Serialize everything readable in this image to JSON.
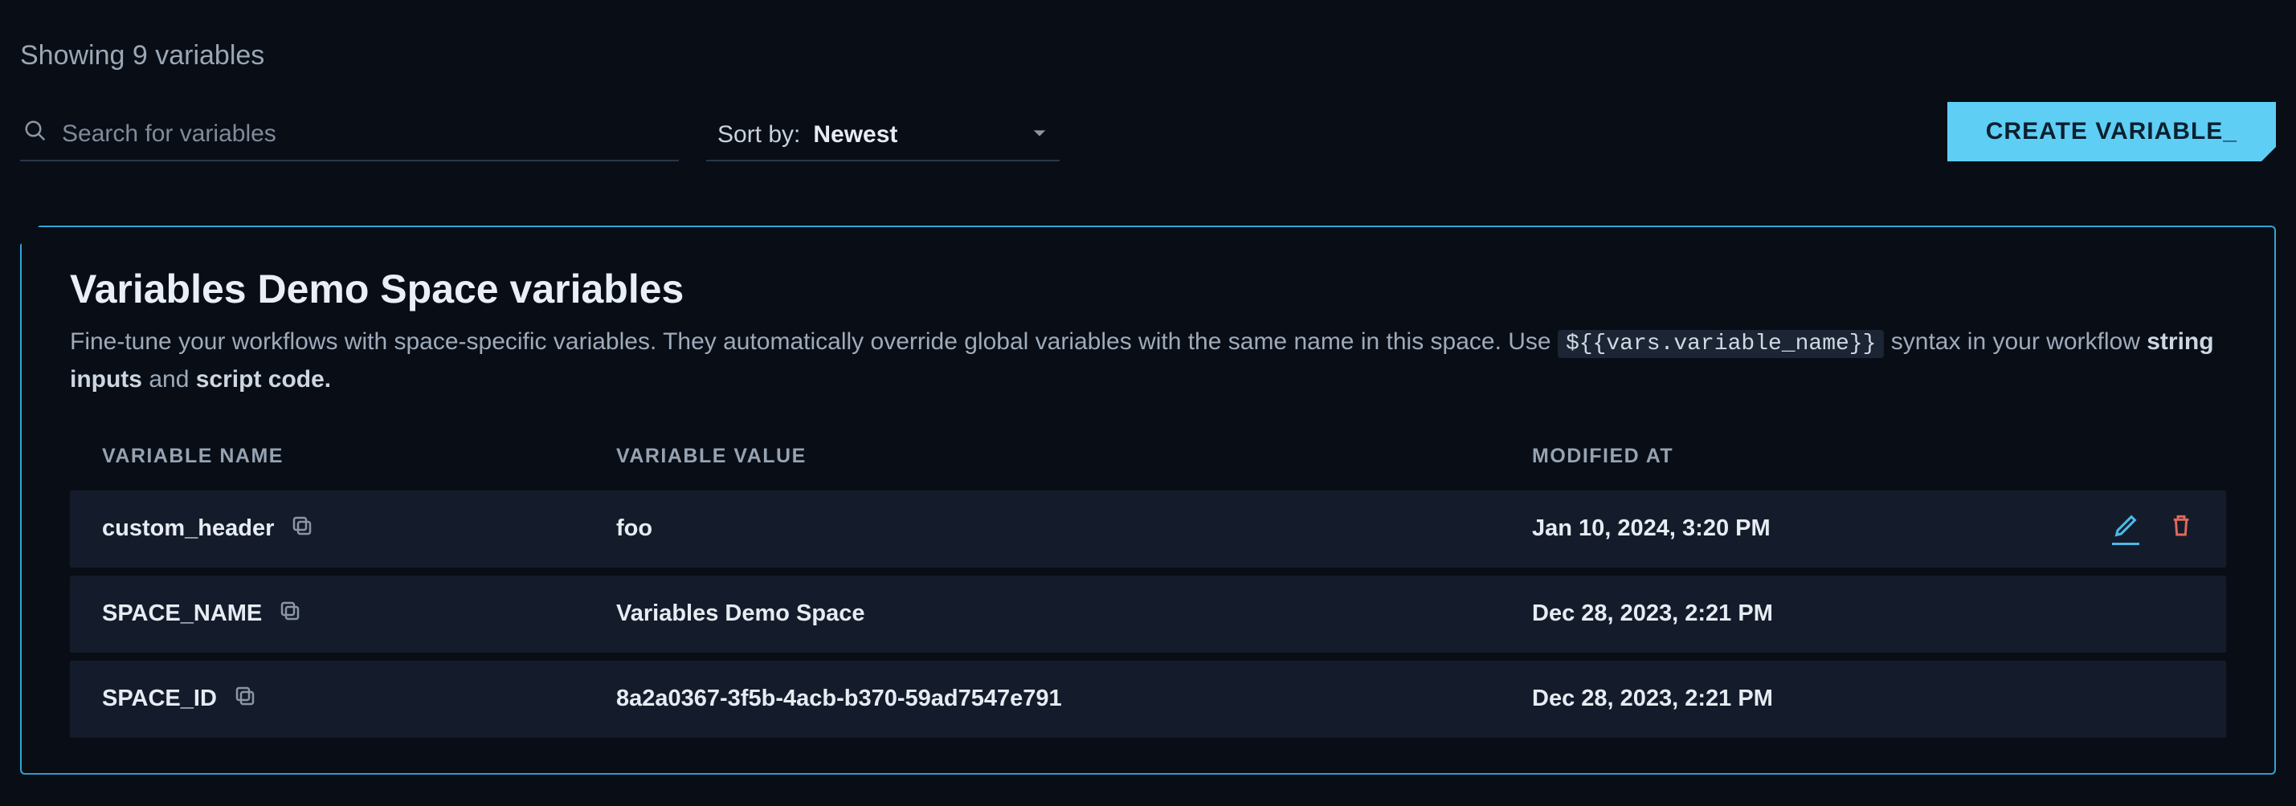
{
  "summary": "Showing 9 variables",
  "search": {
    "placeholder": "Search for variables"
  },
  "sort": {
    "label": "Sort by:",
    "value": "Newest"
  },
  "create_button": "CREATE VARIABLE_",
  "panel": {
    "title": "Variables Demo Space variables",
    "desc_pre": "Fine-tune your workflows with space-specific variables. They automatically override global variables with the same name in this space. Use ",
    "desc_code": "${{vars.variable_name}}",
    "desc_mid": " syntax in your workflow ",
    "desc_bold1": "string inputs",
    "desc_and": " and ",
    "desc_bold2": "script code."
  },
  "columns": {
    "name": "VARIABLE NAME",
    "value": "VARIABLE VALUE",
    "modified": "MODIFIED AT"
  },
  "rows": [
    {
      "name": "custom_header",
      "value": "foo",
      "modified": "Jan 10, 2024, 3:20 PM",
      "show_actions": true
    },
    {
      "name": "SPACE_NAME",
      "value": "Variables Demo Space",
      "modified": "Dec 28, 2023, 2:21 PM",
      "show_actions": false
    },
    {
      "name": "SPACE_ID",
      "value": "8a2a0367-3f5b-4acb-b370-59ad7547e791",
      "modified": "Dec 28, 2023, 2:21 PM",
      "show_actions": false
    }
  ]
}
